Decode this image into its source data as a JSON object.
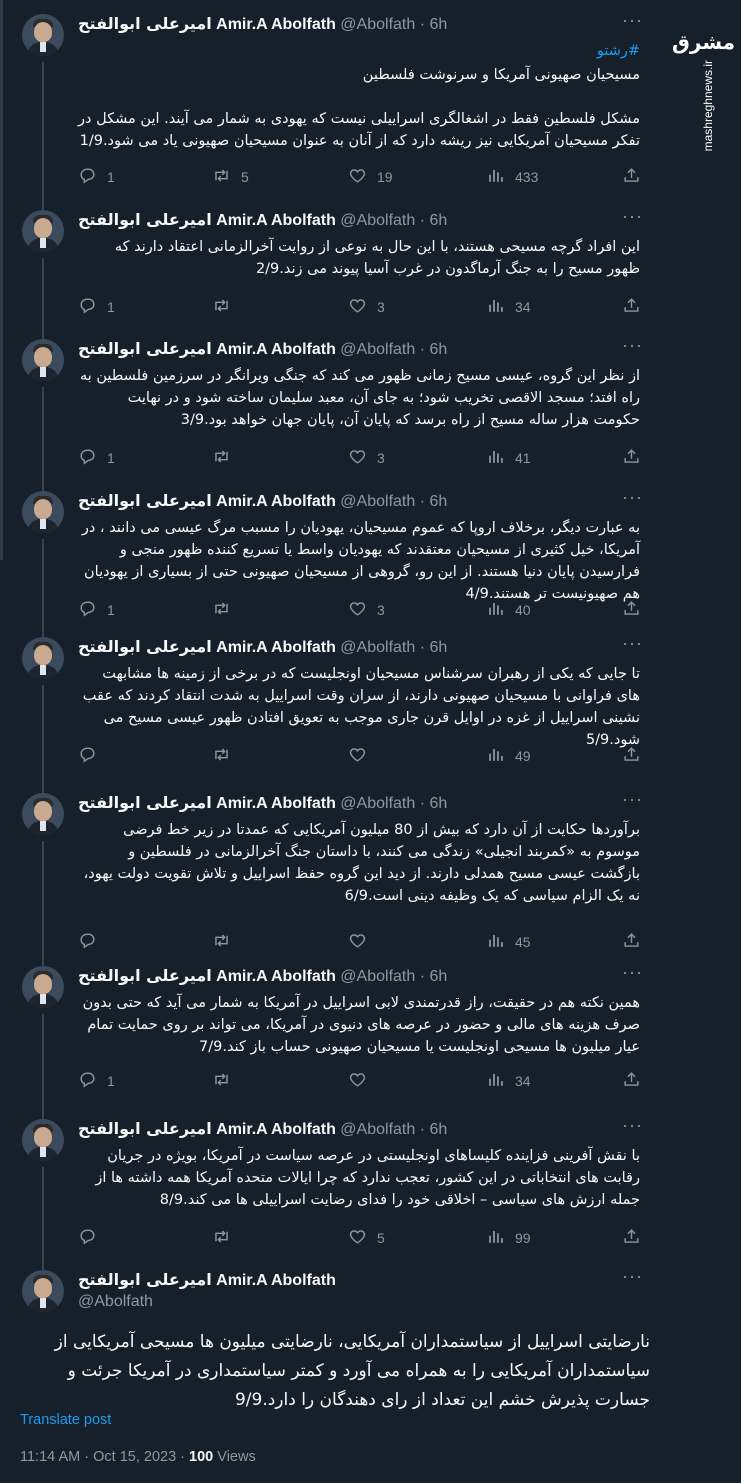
{
  "author": {
    "display_name": "Amir.A Abolfath",
    "persian_name": "امیرعلی ابوالفتح",
    "handle": "@Abolfath",
    "time": "6h"
  },
  "more_label": "···",
  "watermark": {
    "logo": "مشرق",
    "url": "mashreghnews.ir"
  },
  "tweets": [
    {
      "hashtag": "#رشتو",
      "text": "مسیحیان صهیونی آمریکا و سرنوشت فلسطین\n\nمشکل فلسطین فقط در اشغالگری اسراییلی نیست که یهودی به شمار می آیند. این مشکل در تفکر مسیحیان آمریکایی نیز ریشه دارد که از آنان به عنوان مسیحیان صهیونی یاد می شود.1/9",
      "replies": "1",
      "reposts": "5",
      "likes": "19",
      "views": "433"
    },
    {
      "hashtag": "",
      "text": "این افراد گرچه مسیحی هستند، با این حال به نوعی از روایت آخرالزمانی اعتقاد دارند که ظهور مسیح را به جنگ آرماگدون در غرب آسیا پیوند می زند.2/9",
      "replies": "1",
      "reposts": "",
      "likes": "3",
      "views": "34"
    },
    {
      "hashtag": "",
      "text": "از نظر این گروه، عیسی مسیح زمانی ظهور می کند که جنگی ویرانگر در سرزمین فلسطین به راه افتد؛ مسجد الاقصی تخریب شود؛ به جای آن، معبد سلیمان ساخته شود و در نهایت حکومت هزار ساله مسیح از راه برسد که پایان آن، پایان جهان خواهد بود.3/9",
      "replies": "1",
      "reposts": "",
      "likes": "3",
      "views": "41"
    },
    {
      "hashtag": "",
      "text": "به عبارت دیگر، برخلاف اروپا که عموم مسیحیان، یهودیان را مسبب مرگ عیسی می دانند ، در آمریکا، خیل کثیری از مسیحیان معتقدند که یهودیان واسط یا تسریع کننده ظهور منجی و فرارسیدن پایان دنیا هستند. از این رو، گروهی از مسیحیان صهیونی حتی از بسیاری از یهودیان هم صهیونیست تر هستند.4/9",
      "replies": "1",
      "reposts": "",
      "likes": "3",
      "views": "40"
    },
    {
      "hashtag": "",
      "text": "تا جایی که یکی از رهبران سرشناس مسیحیان اونجلیست که در برخی از زمینه ها مشابهت های فراوانی با مسیحیان صهیونی دارند، از سران وقت اسراییل به شدت انتقاد کردند که عقب نشینی اسراییل از غزه در اوایل قرن جاری موجب به تعویق افتادن ظهور عیسی مسیح می شود.5/9",
      "replies": "",
      "reposts": "",
      "likes": "",
      "views": "49"
    },
    {
      "hashtag": "",
      "text": "برآوردها حکایت از آن دارد که بیش از 80 میلیون آمریکایی که عمدتا در زیر خط فرضی موسوم به «کمربند انجیلی» زندگی می کنند، با داستان جنگ آخرالزمانی در فلسطین و بازگشت عیسی مسیح همدلی دارند. از دید این گروه حفظ اسراییل و تلاش تقویت دولت یهود، نه یک الزام سیاسی که یک وظیفه دینی است.6/9",
      "replies": "",
      "reposts": "",
      "likes": "",
      "views": "45"
    },
    {
      "hashtag": "",
      "text": "همین نکته هم در حقیقت، راز قدرتمندی لابی اسراییل در آمریکا به شمار می آید که حتی بدون صرف هزینه های مالی و حضور در عرصه های دنیوی در آمریکا، می تواند بر روی حمایت تمام عیار میلیون ها مسیحی اونجلیست یا مسیحیان صهیونی حساب باز کند.7/9",
      "replies": "1",
      "reposts": "",
      "likes": "",
      "views": "34"
    },
    {
      "hashtag": "",
      "text": "با نقش آفرینی فزاینده کلیساهای اونجلیستی در عرصه سیاست در آمریکا، بویژه در جریان رقابت های انتخاباتی در این کشور، تعجب ندارد که چرا ایالات متحده آمریکا همه داشته ها از جمله ارزش های سیاسی – اخلاقی خود را فدای رضایت اسراییلی ها می کند.8/9",
      "replies": "",
      "reposts": "",
      "likes": "5",
      "views": "99"
    }
  ],
  "main_tweet": {
    "text": "نارضایتی اسراییل از سیاستمداران آمریکایی، نارضایتی میلیون ها مسیحی آمریکایی از سیاستمداران آمریکایی را به همراه می آورد و کمتر سیاستمداری در آمریکا جرئت و جسارت پذیرش خشم این تعداد از رای دهندگان را دارد.9/9",
    "translate": "Translate post",
    "time": "11:14 AM",
    "date": "Oct 15, 2023",
    "views_count": "100",
    "views_label": "Views",
    "sep": "·"
  },
  "colors": {
    "background": "#15202b",
    "text": "#f7f9f9",
    "muted": "#8b98a5",
    "link": "#1d9bf0"
  }
}
